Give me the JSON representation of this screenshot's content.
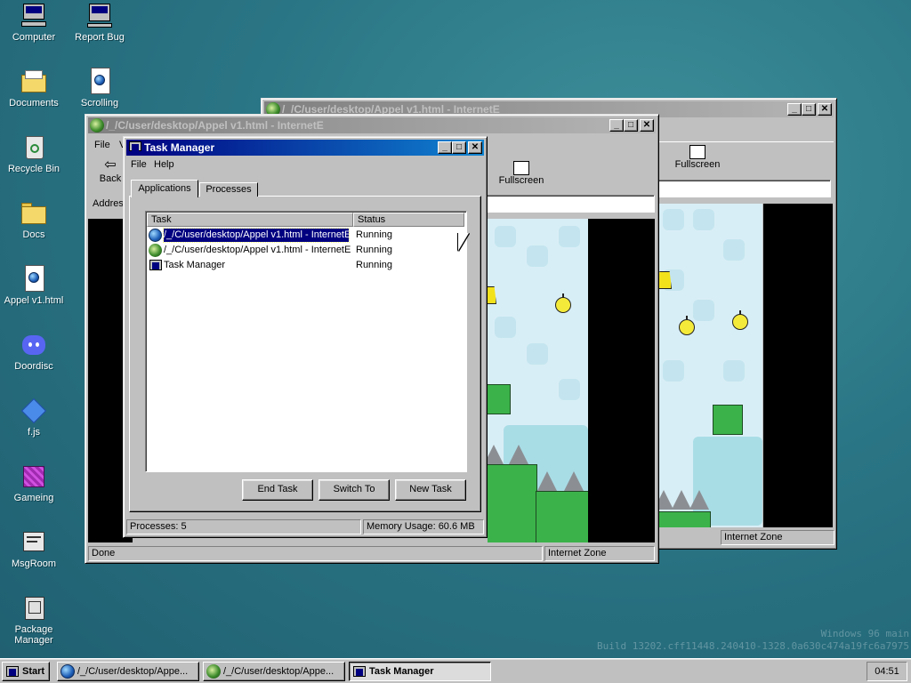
{
  "desktop": {
    "icons": [
      {
        "label": "Computer",
        "icon": "computer-icon"
      },
      {
        "label": "Report Bug",
        "icon": "report-bug-icon"
      },
      {
        "label": "Documents",
        "icon": "documents-folder-icon"
      },
      {
        "label": "Scrolling",
        "icon": "html-file-icon"
      },
      {
        "label": "Recycle Bin",
        "icon": "recycle-bin-icon"
      },
      {
        "label": "Docs",
        "icon": "folder-icon"
      },
      {
        "label": "Appel v1.html",
        "icon": "html-file-icon"
      },
      {
        "label": "Doordisc",
        "icon": "discord-icon"
      },
      {
        "label": "f.js",
        "icon": "js-file-icon"
      },
      {
        "label": "Gameing",
        "icon": "cube-icon"
      },
      {
        "label": "MsgRoom",
        "icon": "msgroom-icon"
      },
      {
        "label": "Package Manager",
        "icon": "package-manager-icon"
      }
    ],
    "watermark_line1": "Windows 96 main",
    "watermark_line2": "Build 13202.cff11448.240410-1328.0a630c474a19fc6a7975"
  },
  "browser_back": {
    "title": "/_/C/user/desktop/Appel v1.html - InternetE",
    "fullscreen_label": "Fullscreen",
    "status_zone": "Internet Zone"
  },
  "browser_front": {
    "title": "/_/C/user/desktop/Appel v1.html - InternetE",
    "menu_file": "File",
    "menu_view_partial": "V",
    "back_label": "Back",
    "fullscreen_label": "Fullscreen",
    "address_label": "Address",
    "status_text": "Done",
    "status_zone": "Internet Zone"
  },
  "task_manager": {
    "title": "Task Manager",
    "menu": [
      "File",
      "Help"
    ],
    "tabs": [
      "Applications",
      "Processes"
    ],
    "columns": [
      "Task",
      "Status"
    ],
    "rows": [
      {
        "task": "/_/C/user/desktop/Appel v1.html - InternetE",
        "status": "Running",
        "selected": true
      },
      {
        "task": "/_/C/user/desktop/Appel v1.html - InternetE",
        "status": "Running",
        "selected": false
      },
      {
        "task": "Task Manager",
        "status": "Running",
        "selected": false
      }
    ],
    "buttons": {
      "end_task": "End Task",
      "switch_to": "Switch To",
      "new_task": "New Task"
    },
    "status_processes": "Processes: 5",
    "status_memory": "Memory Usage: 60.6 MB"
  },
  "taskbar": {
    "start_label": "Start",
    "items": [
      {
        "label": "/_/C/user/desktop/Appe...",
        "pressed": false
      },
      {
        "label": "/_/C/user/desktop/Appe...",
        "pressed": false
      },
      {
        "label": "Task Manager",
        "pressed": true
      }
    ],
    "clock": "04:51"
  }
}
